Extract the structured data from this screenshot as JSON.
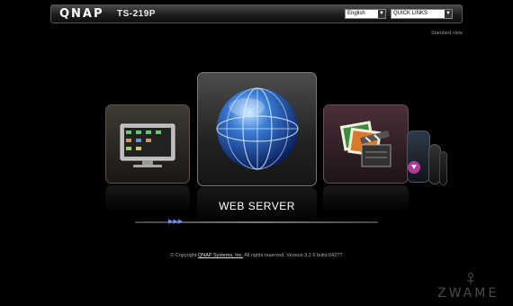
{
  "header": {
    "logo_text": "QNAP",
    "model": "TS-219P",
    "language_value": "English",
    "quick_links_value": "QUICK LINKS"
  },
  "standard_view_label": "Standard view",
  "carousel": {
    "items": [
      {
        "icon": "monitor-icon"
      },
      {
        "label": "WEB SERVER",
        "icon": "globe-icon"
      },
      {
        "icon": "photo-video-icon"
      },
      {
        "icon": "download-icon"
      }
    ]
  },
  "footer": {
    "prefix": "© Copyright",
    "company_link": "QNAP Systems, Inc.",
    "suffix": "All rights reserved. Version 3.2.6 build 0427T"
  },
  "watermark": "ZWAME",
  "colors": {
    "accent": "#3a7bd5",
    "slider_thumb": "#6a8cff"
  }
}
